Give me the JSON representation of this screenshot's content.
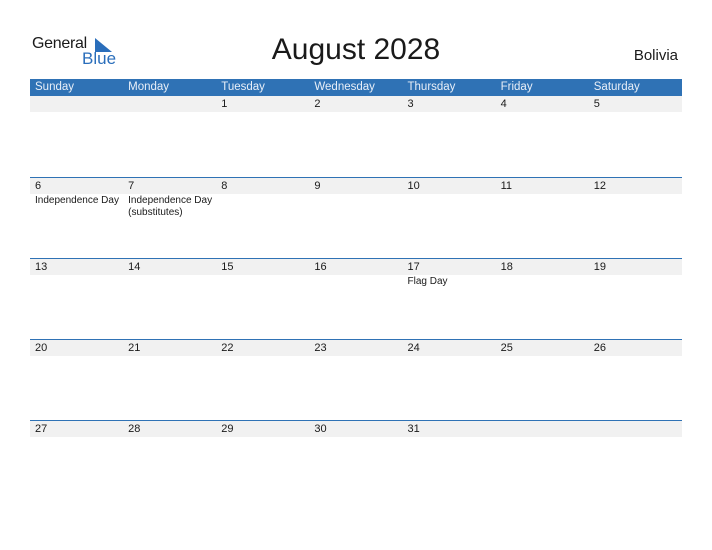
{
  "logo": {
    "general": "General",
    "blue": "Blue"
  },
  "title": "August 2028",
  "country": "Bolivia",
  "weekdays": [
    "Sunday",
    "Monday",
    "Tuesday",
    "Wednesday",
    "Thursday",
    "Friday",
    "Saturday"
  ],
  "weeks": [
    {
      "days": [
        "",
        "",
        "1",
        "2",
        "3",
        "4",
        "5"
      ],
      "events": [
        "",
        "",
        "",
        "",
        "",
        "",
        ""
      ]
    },
    {
      "days": [
        "6",
        "7",
        "8",
        "9",
        "10",
        "11",
        "12"
      ],
      "events": [
        "Independence Day",
        "Independence Day (substitutes)",
        "",
        "",
        "",
        "",
        ""
      ]
    },
    {
      "days": [
        "13",
        "14",
        "15",
        "16",
        "17",
        "18",
        "19"
      ],
      "events": [
        "",
        "",
        "",
        "",
        "Flag Day",
        "",
        ""
      ]
    },
    {
      "days": [
        "20",
        "21",
        "22",
        "23",
        "24",
        "25",
        "26"
      ],
      "events": [
        "",
        "",
        "",
        "",
        "",
        "",
        ""
      ]
    },
    {
      "days": [
        "27",
        "28",
        "29",
        "30",
        "31",
        "",
        ""
      ],
      "events": [
        "",
        "",
        "",
        "",
        "",
        "",
        ""
      ]
    }
  ]
}
